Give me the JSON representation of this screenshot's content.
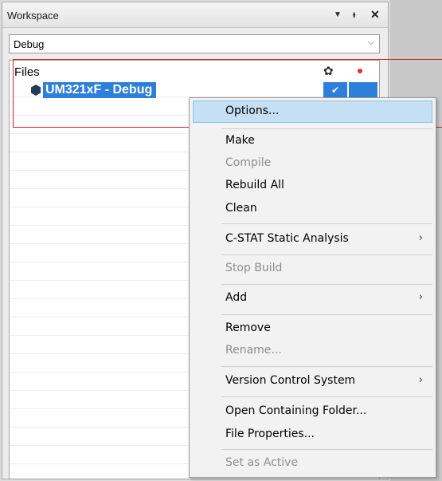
{
  "workspace": {
    "title": "Workspace",
    "config_selected": "Debug",
    "tree": {
      "header_label": "Files",
      "project_name": "UM321xF - Debug",
      "checkmark": "✔"
    }
  },
  "icons": {
    "dropdown": "▼",
    "pin": "ᵻ",
    "close": "✕",
    "chevron": "⌵",
    "gear": "✿",
    "submenu": "›"
  },
  "context_menu": {
    "items": [
      {
        "label": "Options...",
        "enabled": true,
        "selected": true
      },
      {
        "label": "Make",
        "enabled": true
      },
      {
        "label": "Compile",
        "enabled": false
      },
      {
        "label": "Rebuild All",
        "enabled": true
      },
      {
        "label": "Clean",
        "enabled": true
      },
      {
        "label": "C-STAT Static Analysis",
        "enabled": true,
        "submenu": true
      },
      {
        "label": "Stop Build",
        "enabled": false
      },
      {
        "label": "Add",
        "enabled": true,
        "submenu": true
      },
      {
        "label": "Remove",
        "enabled": true
      },
      {
        "label": "Rename...",
        "enabled": false
      },
      {
        "label": "Version Control System",
        "enabled": true,
        "submenu": true
      },
      {
        "label": "Open Containing Folder...",
        "enabled": true
      },
      {
        "label": "File Properties...",
        "enabled": true
      },
      {
        "label": "Set as Active",
        "enabled": false
      }
    ]
  },
  "colors": {
    "selection_blue": "#2e7fd9",
    "menu_highlight": "#c5dff4",
    "annotation_red": "#d0202a",
    "status_dot": "#e0303a"
  }
}
